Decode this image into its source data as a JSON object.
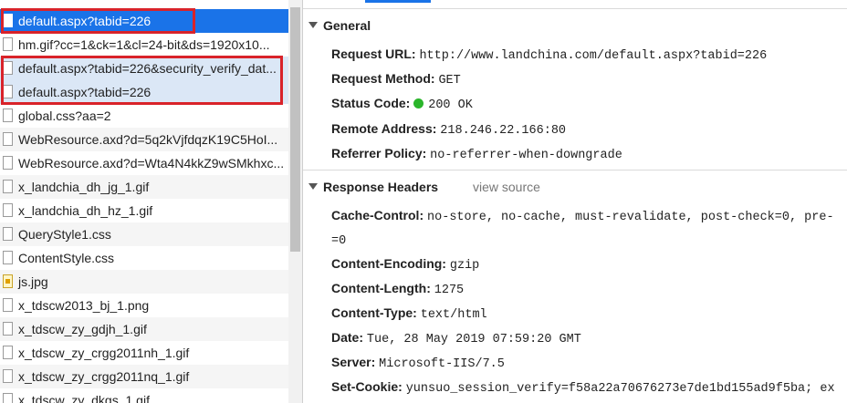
{
  "requests": [
    {
      "name": "default.aspx?tabid=226",
      "icon": "document-icon",
      "state": "selected"
    },
    {
      "name": "hm.gif?cc=1&ck=1&cl=24-bit&ds=1920x10...",
      "icon": "document-icon",
      "state": "normal"
    },
    {
      "name": "default.aspx?tabid=226&security_verify_dat...",
      "icon": "document-icon",
      "state": "highlighted"
    },
    {
      "name": "default.aspx?tabid=226",
      "icon": "document-icon",
      "state": "highlighted"
    },
    {
      "name": "global.css?aa=2",
      "icon": "document-icon",
      "state": "normal"
    },
    {
      "name": "WebResource.axd?d=5q2kVjfdqzK19C5HoI...",
      "icon": "document-icon",
      "state": "alt"
    },
    {
      "name": "WebResource.axd?d=Wta4N4kkZ9wSMkhxc...",
      "icon": "document-icon",
      "state": "normal"
    },
    {
      "name": "x_landchia_dh_jg_1.gif",
      "icon": "document-icon",
      "state": "alt"
    },
    {
      "name": "x_landchia_dh_hz_1.gif",
      "icon": "document-icon",
      "state": "normal"
    },
    {
      "name": "QueryStyle1.css",
      "icon": "document-icon",
      "state": "alt"
    },
    {
      "name": "ContentStyle.css",
      "icon": "document-icon",
      "state": "normal"
    },
    {
      "name": "js.jpg",
      "icon": "image-icon",
      "state": "alt"
    },
    {
      "name": "x_tdscw2013_bj_1.png",
      "icon": "document-icon",
      "state": "normal"
    },
    {
      "name": "x_tdscw_zy_gdjh_1.gif",
      "icon": "document-icon",
      "state": "alt"
    },
    {
      "name": "x_tdscw_zy_crgg2011nh_1.gif",
      "icon": "document-icon",
      "state": "normal"
    },
    {
      "name": "x_tdscw_zy_crgg2011nq_1.gif",
      "icon": "document-icon",
      "state": "alt"
    },
    {
      "name": "x_tdscw_zy_dkgs_1.gif",
      "icon": "document-icon",
      "state": "normal"
    }
  ],
  "general": {
    "title": "General",
    "request_url_label": "Request URL:",
    "request_url": "http://www.landchina.com/default.aspx?tabid=226",
    "request_method_label": "Request Method:",
    "request_method": "GET",
    "status_code_label": "Status Code:",
    "status_code": "200 OK",
    "status_color": "#2bb52b",
    "remote_address_label": "Remote Address:",
    "remote_address": "218.246.22.166:80",
    "referrer_policy_label": "Referrer Policy:",
    "referrer_policy": "no-referrer-when-downgrade"
  },
  "response_headers": {
    "title": "Response Headers",
    "view_source": "view source",
    "cache_control_label": "Cache-Control:",
    "cache_control": "no-store, no-cache, must-revalidate, post-check=0, pre-",
    "cache_control_wrap": "=0",
    "content_encoding_label": "Content-Encoding:",
    "content_encoding": "gzip",
    "content_length_label": "Content-Length:",
    "content_length": "1275",
    "content_type_label": "Content-Type:",
    "content_type": "text/html",
    "date_label": "Date:",
    "date": "Tue, 28 May 2019 07:59:20 GMT",
    "server_label": "Server:",
    "server": "Microsoft-IIS/7.5",
    "set_cookie_label": "Set-Cookie:",
    "set_cookie": "yunsuo_session_verify=f58a22a70676273e7de1bd155ad9f5ba; ex"
  },
  "colors": {
    "selected_row": "#1a73e8",
    "highlight_row": "#dbe7f6",
    "annotation_box": "#d9232a"
  }
}
